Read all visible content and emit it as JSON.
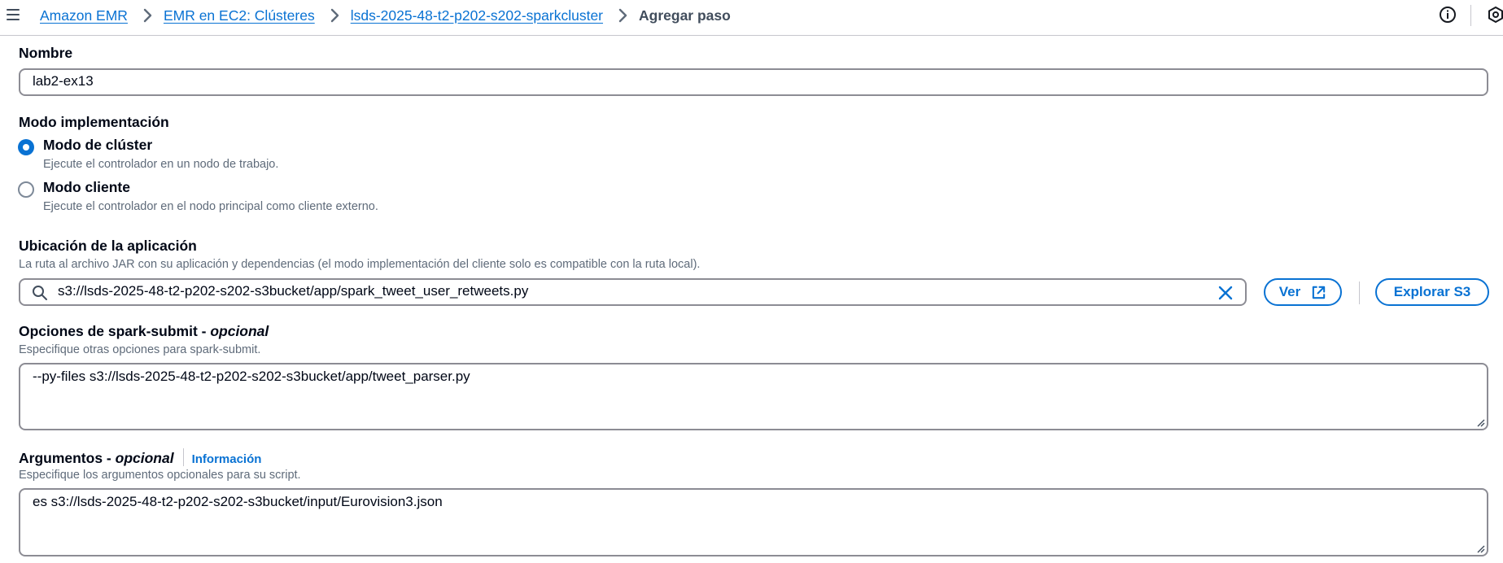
{
  "breadcrumbs": {
    "items": [
      "Amazon EMR",
      "EMR en EC2: Clústeres",
      "lsds-2025-48-t2-p202-s202-sparkcluster"
    ],
    "current": "Agregar paso"
  },
  "form": {
    "name": {
      "label": "Nombre",
      "value": "lab2-ex13"
    },
    "deploy_mode": {
      "label": "Modo implementación",
      "options": [
        {
          "label": "Modo de clúster",
          "description": "Ejecute el controlador en un nodo de trabajo.",
          "selected": true
        },
        {
          "label": "Modo cliente",
          "description": "Ejecute el controlador en el nodo principal como cliente externo.",
          "selected": false
        }
      ]
    },
    "app_location": {
      "label": "Ubicación de la aplicación",
      "description": "La ruta al archivo JAR con su aplicación y dependencias (el modo implementación del cliente solo es compatible con la ruta local).",
      "value": "s3://lsds-2025-48-t2-p202-s202-s3bucket/app/spark_tweet_user_retweets.py",
      "view_button": "Ver",
      "browse_button": "Explorar S3"
    },
    "spark_options": {
      "label": "Opciones de spark-submit - ",
      "optional": "opcional",
      "description": "Especifique otras opciones para spark-submit.",
      "value": "--py-files s3://lsds-2025-48-t2-p202-s202-s3bucket/app/tweet_parser.py"
    },
    "arguments": {
      "label": "Argumentos - ",
      "optional": "opcional",
      "info_link": "Información",
      "description": "Especifique los argumentos opcionales para su script.",
      "value": "es s3://lsds-2025-48-t2-p202-s202-s3bucket/input/Eurovision3.json"
    }
  },
  "colors": {
    "link": "#0972d3",
    "text": "#000716",
    "muted": "#5f6b7a",
    "border": "#8c8c94"
  },
  "icons": [
    "menu-icon",
    "chevron-right-icon",
    "info-icon",
    "notifications-icon",
    "search-icon",
    "clear-icon",
    "external-link-icon",
    "resize-handle-icon"
  ]
}
